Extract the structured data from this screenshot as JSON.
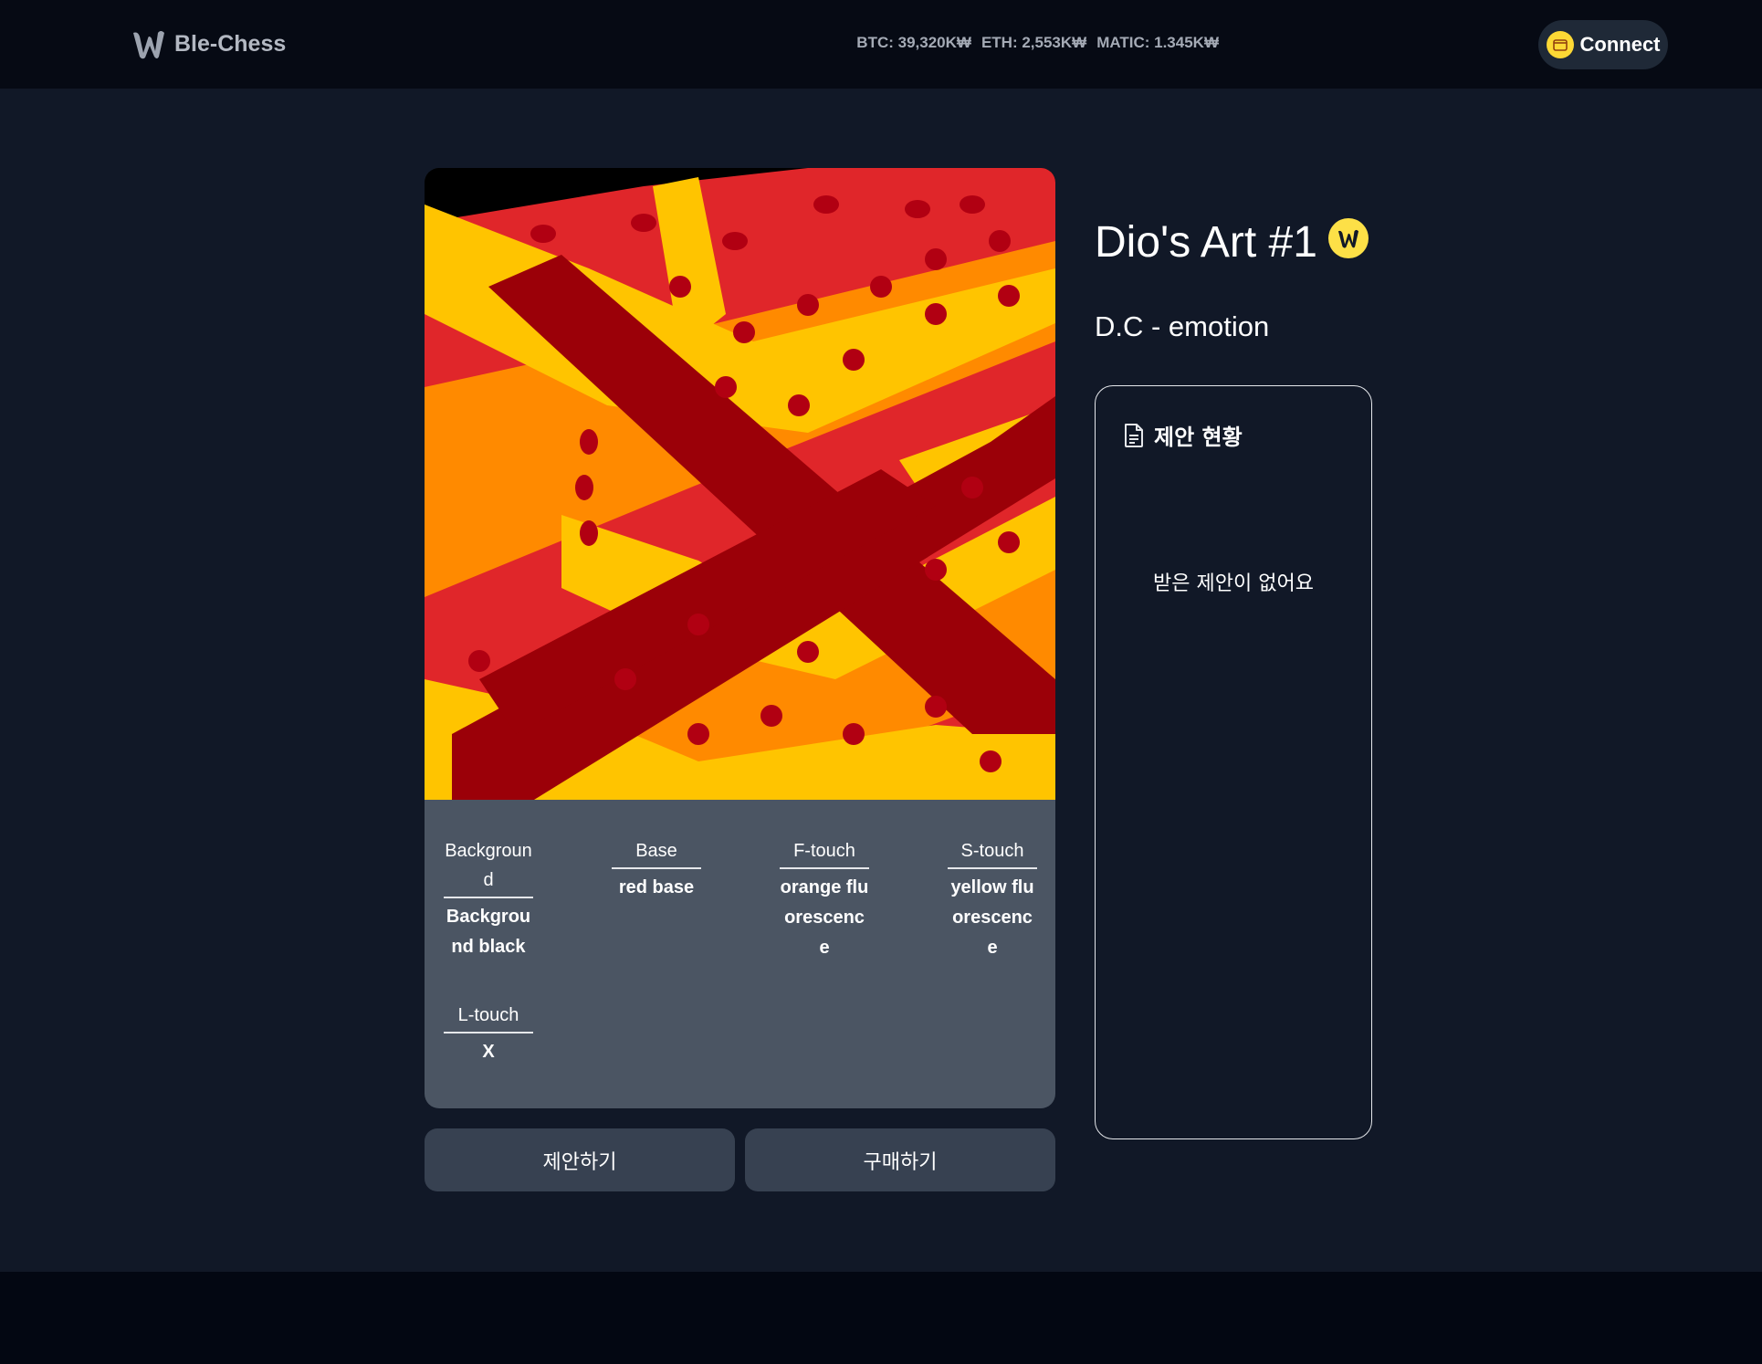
{
  "header": {
    "logo_icon": "ble-chess-logo-icon",
    "brand": "Ble-Chess",
    "prices": [
      {
        "label": "BTC: 39,320K₩"
      },
      {
        "label": "ETH: 2,553K₩"
      },
      {
        "label": "MATIC: 1.345K₩"
      }
    ],
    "connect_icon": "wallet-icon",
    "connect_label": "Connect"
  },
  "nft": {
    "title": "Dio's Art #1",
    "badge_icon": "verified-logo-badge-icon",
    "subtitle": "D.C - emotion",
    "traits": [
      {
        "name": "Background",
        "value": "Background black"
      },
      {
        "name": "Base",
        "value": "red base"
      },
      {
        "name": "F-touch",
        "value": "orange fluorescence"
      },
      {
        "name": "S-touch",
        "value": "yellow fluorescence"
      },
      {
        "name": "L-touch",
        "value": "X"
      }
    ],
    "buttons": {
      "offer": "제안하기",
      "buy": "구매하기"
    }
  },
  "offers": {
    "icon": "document-icon",
    "title": "제안 현황",
    "empty_text": "받은 제안이 없어요"
  },
  "colors": {
    "page_bg": "#111827",
    "header_bg": "#060a14",
    "card_bg": "#4b5563",
    "button_bg": "#374151",
    "accent_yellow": "#fde047",
    "art_red": "#e0262a",
    "art_dark_red": "#9b0008",
    "art_orange": "#ff8a00",
    "art_yellow": "#ffc400"
  }
}
